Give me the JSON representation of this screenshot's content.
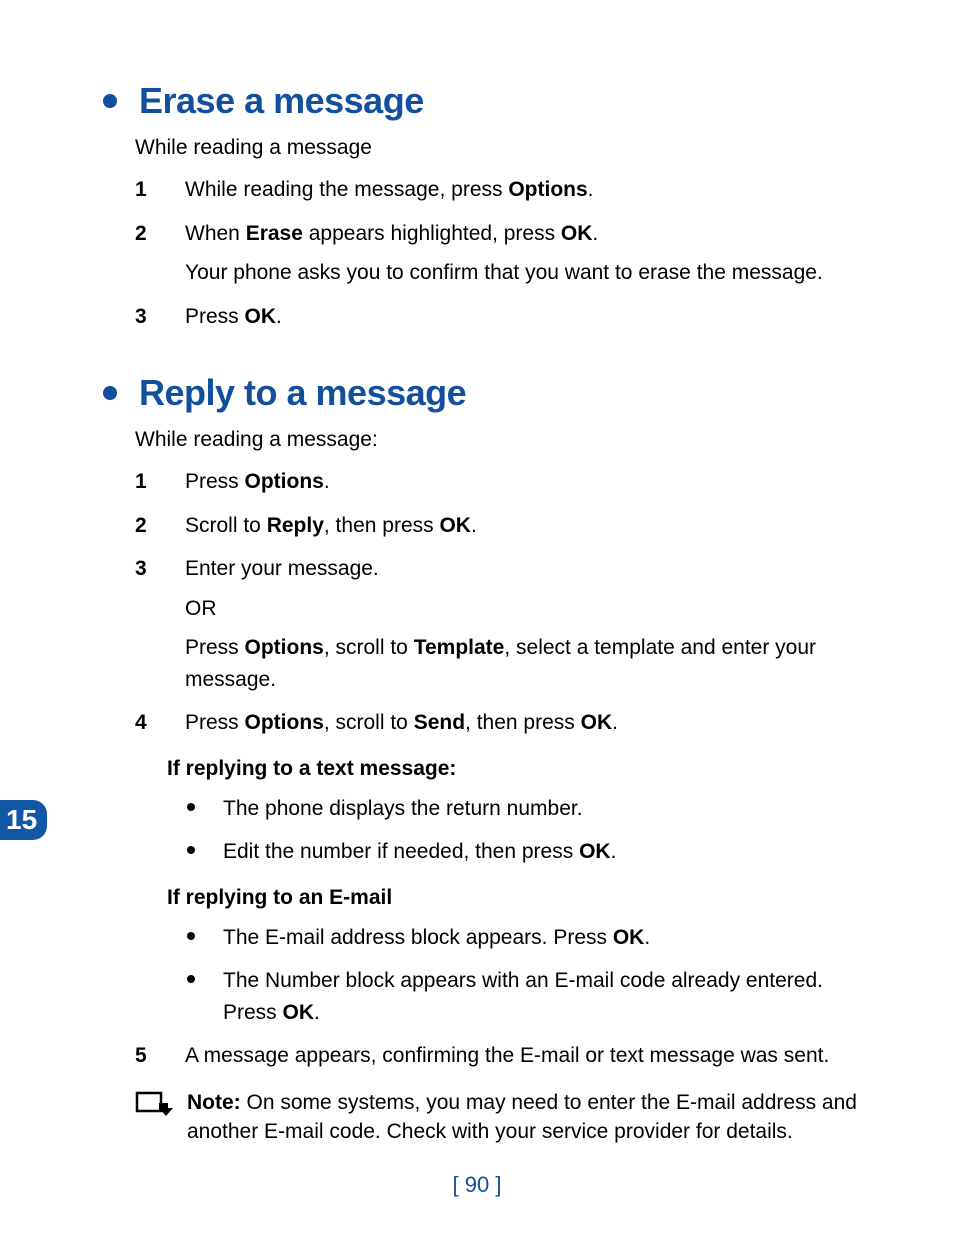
{
  "chapter_tab": "15",
  "page_number": "[ 90 ]",
  "erase": {
    "heading": "Erase a message",
    "intro": "While reading a message",
    "steps": [
      {
        "num": "1",
        "paras": [
          {
            "segments": [
              "While reading the message, press ",
              {
                "b": "Options"
              },
              "."
            ]
          }
        ]
      },
      {
        "num": "2",
        "paras": [
          {
            "segments": [
              "When ",
              {
                "b": "Erase"
              },
              " appears highlighted, press ",
              {
                "b": "OK"
              },
              "."
            ]
          },
          {
            "segments": [
              "Your phone asks you to confirm that you want to erase the message."
            ]
          }
        ]
      },
      {
        "num": "3",
        "paras": [
          {
            "segments": [
              "Press ",
              {
                "b": "OK"
              },
              "."
            ]
          }
        ]
      }
    ]
  },
  "reply": {
    "heading": "Reply to a message",
    "intro": "While reading a message:",
    "steps": [
      {
        "num": "1",
        "paras": [
          {
            "segments": [
              "Press ",
              {
                "b": "Options"
              },
              "."
            ]
          }
        ]
      },
      {
        "num": "2",
        "paras": [
          {
            "segments": [
              "Scroll to ",
              {
                "b": "Reply"
              },
              ", then press ",
              {
                "b": "OK"
              },
              "."
            ]
          }
        ]
      },
      {
        "num": "3",
        "paras": [
          {
            "segments": [
              "Enter your message."
            ]
          },
          {
            "segments": [
              "OR"
            ]
          },
          {
            "segments": [
              "Press ",
              {
                "b": "Options"
              },
              ", scroll to ",
              {
                "b": "Template"
              },
              ", select a template and enter your message."
            ]
          }
        ]
      },
      {
        "num": "4",
        "paras": [
          {
            "segments": [
              "Press ",
              {
                "b": "Options"
              },
              ", scroll to ",
              {
                "b": "Send"
              },
              ", then press ",
              {
                "b": "OK"
              },
              "."
            ]
          }
        ]
      }
    ],
    "subsections": [
      {
        "head": "If replying to a text message:",
        "bullets": [
          {
            "segments": [
              "The phone displays the return number."
            ]
          },
          {
            "segments": [
              "Edit the number if needed, then press ",
              {
                "b": "OK"
              },
              "."
            ]
          }
        ]
      },
      {
        "head": "If replying to an E-mail",
        "bullets": [
          {
            "segments": [
              "The E-mail address block appears. Press ",
              {
                "b": "OK"
              },
              "."
            ]
          },
          {
            "segments": [
              "The Number block appears with an E-mail code already entered. Press ",
              {
                "b": "OK"
              },
              "."
            ]
          }
        ]
      }
    ],
    "steps2": [
      {
        "num": "5",
        "paras": [
          {
            "segments": [
              "A message appears, confirming the E-mail or text message was sent."
            ]
          }
        ]
      }
    ],
    "note": {
      "label": "Note:",
      "text": " On some systems, you may need to enter the E-mail address and another E-mail code. Check with your service provider for details."
    }
  }
}
